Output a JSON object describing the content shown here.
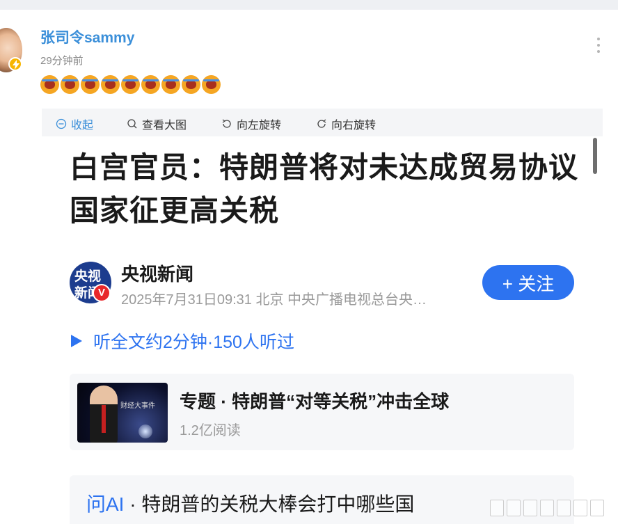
{
  "post": {
    "username": "张司令sammy",
    "time": "29分钟前",
    "emoji_count": 9
  },
  "toolbar": {
    "collapse": "收起",
    "view_large": "查看大图",
    "rotate_left": "向左旋转",
    "rotate_right": "向右旋转"
  },
  "article": {
    "headline": "白宫官员：特朗普将对未达成贸易协议国家征更高关税",
    "source": {
      "logo_line1": "央视",
      "logo_line2": "新闻",
      "name": "央视新闻",
      "meta": "2025年7月31日09:31 北京 中央广播电视总台央…"
    },
    "follow_label": "+ 关注",
    "listen_label": "听全文约2分钟·150人听过",
    "topic": {
      "title": "专题 · 特朗普“对等关税”冲击全球",
      "reads": "1.2亿阅读",
      "thumb_caption": "财经大事件"
    },
    "ask_ai": {
      "label": "问AI",
      "question": " · 特朗普的关税大棒会打中哪些国"
    }
  },
  "colors": {
    "username": "#3b8fd9",
    "accent_blue": "#2d73f0",
    "verified_red": "#e8272a"
  }
}
